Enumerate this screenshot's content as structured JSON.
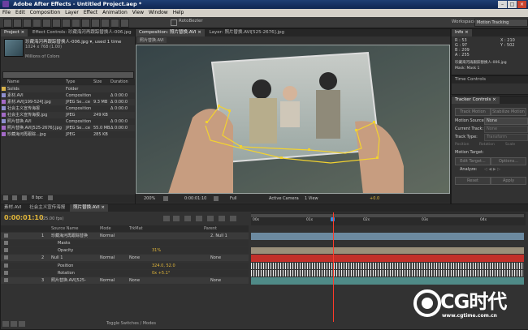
{
  "app": {
    "title": "Adobe After Effects - Untitled Project.aep *",
    "menu": [
      "File",
      "Edit",
      "Composition",
      "Layer",
      "Effect",
      "Animation",
      "View",
      "Window",
      "Help"
    ]
  },
  "toolbar": {
    "rotobezier_label": "RotoBezier",
    "workspace_label": "Workspace:",
    "workspace_value": "Motion Tracking"
  },
  "project": {
    "tab_project": "Project ×",
    "tab_effect": "Effect Controls: 珍藏海河再跟踪替换人-006.jpg",
    "item_name": "珍藏海河再跟踪替换人-006.jpg ▾, used 1 time",
    "item_dims": "1024 x 768 (1.00)",
    "item_colors": "Millions of Colors",
    "columns": [
      "Name",
      "Type",
      "Size",
      "Duration"
    ],
    "rows": [
      {
        "name": "Solids",
        "type": "Folder",
        "size": "",
        "dur": "",
        "color": "#d8b24a"
      },
      {
        "name": "素材.AVI",
        "type": "Composition",
        "size": "",
        "dur": "Δ 0:00:0",
        "color": "#8f8fcf"
      },
      {
        "name": "素材.AVI[199-524].jpg",
        "type": "JPEG Se...ce",
        "size": "9.3 MB",
        "dur": "Δ 0:00:0",
        "color": "#a46ac8"
      },
      {
        "name": "社会主义宣传海报",
        "type": "Composition",
        "size": "",
        "dur": "Δ 0:00:0",
        "color": "#8f8fcf"
      },
      {
        "name": "社会主义宣传海报.jpg",
        "type": "JPEG",
        "size": "249 KB",
        "dur": "",
        "color": "#a46ac8"
      },
      {
        "name": "照片替换.AVI",
        "type": "Composition",
        "size": "",
        "dur": "Δ 0:00:0",
        "color": "#8f8fcf"
      },
      {
        "name": "照片替换.AVI[525-2676].jpg",
        "type": "JPEG Se...ce",
        "size": "55.0 MB",
        "dur": "Δ 0:00:0",
        "color": "#a46ac8"
      },
      {
        "name": "珍藏海河再跟踪...jpg",
        "type": "JPEG",
        "size": "285 KB",
        "dur": "",
        "color": "#a46ac8"
      }
    ],
    "bpc": "8 bpc"
  },
  "viewer": {
    "tab_comp": "Composition: 照片替换.AVI ×",
    "tab_layer": "Layer: 照片替换.AVI[525-2676].jpg",
    "tab_sub": "照片替换.AVI",
    "zoom": "200%",
    "time": "0:00:01:10",
    "resolution": "Full",
    "camera": "Active Camera",
    "views": "1 View",
    "exposure": "+0.0"
  },
  "info": {
    "tab": "Info ×",
    "r": "R : 53",
    "g": "G : 97",
    "b": "B : 209",
    "a": "A : 255",
    "x": "X : 210",
    "y": "Y : 502",
    "file": "珍藏海河再跟踪替换人-006.jpg",
    "mask": "Mask: Mask 1"
  },
  "time_controls": {
    "tab": "Time Controls"
  },
  "tracker": {
    "tab": "Tracker Controls ×",
    "track_motion": "Track Motion",
    "stabilize": "Stabilize Motion",
    "motion_source_label": "Motion Source:",
    "motion_source_value": "None",
    "current_track_label": "Current Track:",
    "current_track_value": "None",
    "track_type_label": "Track Type:",
    "track_type_value": "Transform",
    "opts": [
      "Position",
      "Rotation",
      "Scale"
    ],
    "motion_target_label": "Motion Target:",
    "edit_target": "Edit Target...",
    "options": "Options...",
    "analyze_label": "Analyze:",
    "reset": "Reset",
    "apply": "Apply"
  },
  "timeline": {
    "tabs": [
      "素材.AVI",
      "社会主义宣传海报",
      "照片替换.AVI ×"
    ],
    "timecode": "0:00:01:10",
    "fps": "(25.00 fps)",
    "col_source": "Source Name",
    "col_mode": "Mode",
    "col_trkmat": "TrkMat",
    "col_parent": "Parent",
    "ruler": [
      "00s",
      "01s",
      "02s",
      "03s",
      "04s"
    ],
    "layers": [
      {
        "num": "1",
        "name": "珍藏海河再跟踪替换",
        "mode": "Normal",
        "parent": "2. Null 1"
      },
      {
        "num": "",
        "name": "Masks",
        "mode": "",
        "parent": ""
      },
      {
        "num": "",
        "name": "Opacity",
        "value": "31%",
        "mode": "",
        "parent": ""
      },
      {
        "num": "2",
        "name": "Null 1",
        "mode": "Normal",
        "trkmat": "None",
        "parent": "None"
      },
      {
        "num": "",
        "name": "Position",
        "value": "324.0, 52.0",
        "mode": "",
        "parent": ""
      },
      {
        "num": "",
        "name": "Rotation",
        "value": "0x +5.1°",
        "mode": "",
        "parent": ""
      },
      {
        "num": "3",
        "name": "照片替换.AVI[525-",
        "mode": "Normal",
        "trkmat": "None",
        "parent": "None"
      }
    ],
    "toggle": "Toggle Switches / Modes"
  },
  "watermark": {
    "brand": "CG时代",
    "url": "www.cgtime.com.cn"
  },
  "colors": {
    "accent": "#e2b73a",
    "playhead": "#ff3a2a",
    "mask": "#f2d230"
  }
}
